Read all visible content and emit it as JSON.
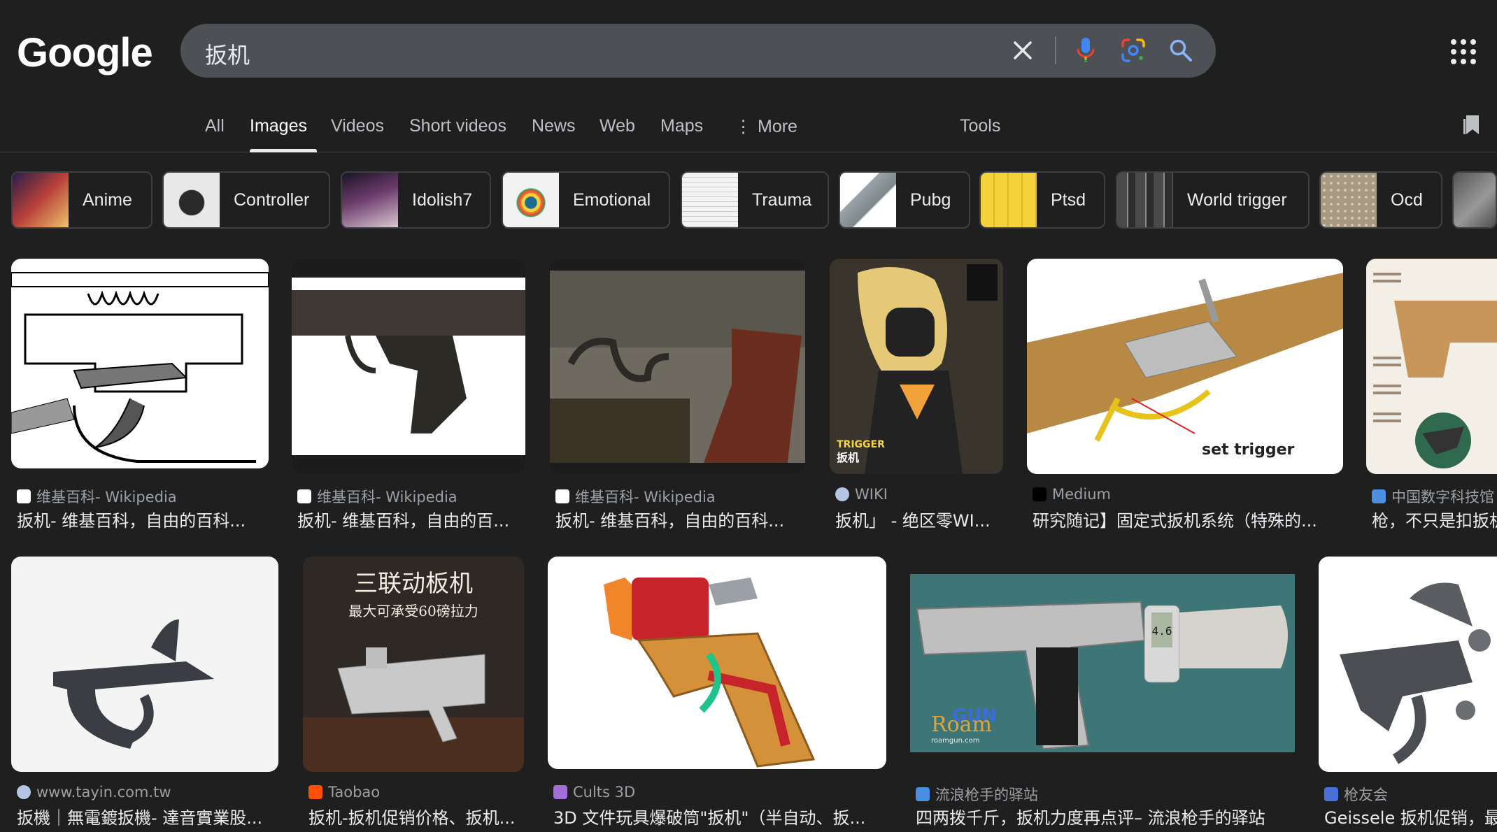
{
  "header": {
    "logo": "Google",
    "query": "扳机"
  },
  "tabs": [
    {
      "label": "All"
    },
    {
      "label": "Images"
    },
    {
      "label": "Videos"
    },
    {
      "label": "Short videos"
    },
    {
      "label": "News"
    },
    {
      "label": "Web"
    },
    {
      "label": "Maps"
    },
    {
      "label": "More"
    },
    {
      "label": "Tools"
    }
  ],
  "chips": [
    {
      "label": "Anime"
    },
    {
      "label": "Controller"
    },
    {
      "label": "Idolish7"
    },
    {
      "label": "Emotional"
    },
    {
      "label": "Trauma"
    },
    {
      "label": "Pubg"
    },
    {
      "label": "Ptsd"
    },
    {
      "label": "World trigger"
    },
    {
      "label": "Ocd"
    }
  ],
  "results": [
    {
      "source": "维基百科- Wikipedia",
      "title": "扳机- 维基百科，自由的百科..."
    },
    {
      "source": "维基百科- Wikipedia",
      "title": "扳机- 维基百科，自由的百..."
    },
    {
      "source": "维基百科- Wikipedia",
      "title": "扳机- 维基百科，自由的百科..."
    },
    {
      "source": "WIKI",
      "title": "扳机」 - 绝区零WI..."
    },
    {
      "source": "Medium",
      "title": "研究随记】固定式扳机系统（特殊的..."
    },
    {
      "source": "中国数字科技馆",
      "title": "枪，不只是扣扳机"
    },
    {
      "source": "www.tayin.com.tw",
      "title": "扳機｜無電鍍扳機- 達音實業股..."
    },
    {
      "source": "Taobao",
      "title": "扳机-扳机促销价格、扳机..."
    },
    {
      "source": "Cults 3D",
      "title": "3D 文件玩具爆破筒\"扳机\"（半自动、扳..."
    },
    {
      "source": "流浪枪手的驿站",
      "title": "四两拨千斤，扳机力度再点评– 流浪枪手的驿站"
    },
    {
      "source": "枪友会",
      "title": "Geissele 扳机促销，最"
    }
  ],
  "image_text": {
    "set_trigger": "set trigger",
    "trigger_label": "TRIGGER",
    "trigger_cn": "扳机",
    "three_link": "三联动板机",
    "three_link_sub": "最大可承受60磅拉力",
    "gun_roam": "GUN",
    "roam": "Roam",
    "roam_url": "roamgun.com",
    "readout": "4.6"
  }
}
